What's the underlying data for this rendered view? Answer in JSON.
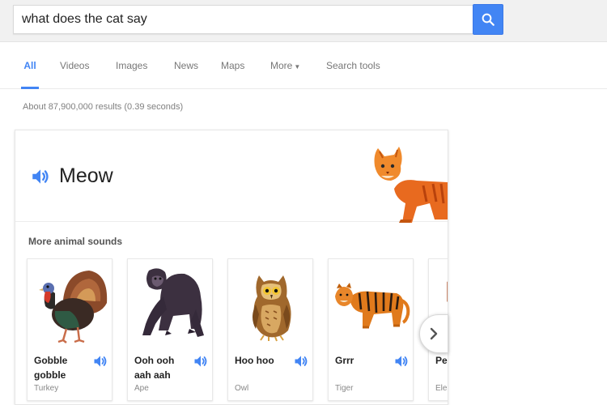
{
  "search": {
    "query": "what does the cat say"
  },
  "tabs": [
    {
      "label": "All",
      "active": true
    },
    {
      "label": "Videos"
    },
    {
      "label": "Images"
    },
    {
      "label": "News"
    },
    {
      "label": "Maps"
    },
    {
      "label": "More"
    },
    {
      "label": "Search tools"
    }
  ],
  "results": {
    "stats": "About 87,900,000 results (0.39 seconds)"
  },
  "answer": {
    "word": "Meow"
  },
  "more_sounds": {
    "title": "More animal sounds",
    "animals": [
      {
        "sound": "Gobble gobble",
        "name": "Turkey"
      },
      {
        "sound": "Ooh ooh aah aah",
        "name": "Ape"
      },
      {
        "sound": "Hoo hoo",
        "name": "Owl"
      },
      {
        "sound": "Grrr",
        "name": "Tiger"
      },
      {
        "sound": "Pe",
        "name": "Ele"
      }
    ]
  },
  "colors": {
    "accent": "#4285f4"
  }
}
